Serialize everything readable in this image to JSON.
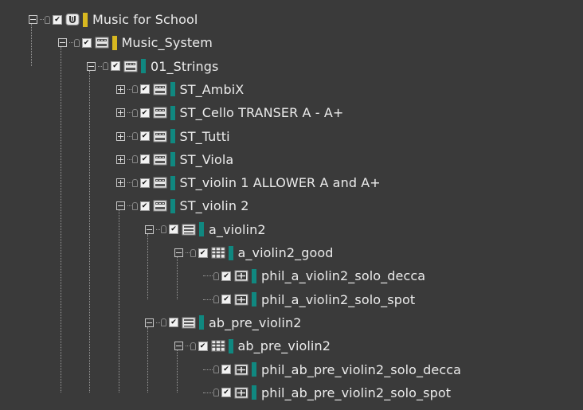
{
  "colors": {
    "background": "#3a3a3a",
    "yellow": "#d8b820",
    "teal": "#108880"
  },
  "tree": [
    {
      "label": "Music for School",
      "depth": 0,
      "expander": "minus",
      "icon": "master-bus-icon",
      "color": "#d8b820"
    },
    {
      "label": "Music_System",
      "depth": 1,
      "expander": "minus",
      "icon": "folder-bus-icon",
      "color": "#d8b820"
    },
    {
      "label": "01_Strings",
      "depth": 2,
      "expander": "minus",
      "icon": "folder-bus-icon",
      "color": "#108880"
    },
    {
      "label": "ST_AmbiX",
      "depth": 3,
      "expander": "plus",
      "icon": "folder-bus-icon",
      "color": "#108880"
    },
    {
      "label": "ST_Cello TRANSER A - A+",
      "depth": 3,
      "expander": "plus",
      "icon": "folder-bus-icon",
      "color": "#108880"
    },
    {
      "label": "ST_Tutti",
      "depth": 3,
      "expander": "plus",
      "icon": "folder-bus-icon",
      "color": "#108880"
    },
    {
      "label": "ST_Viola",
      "depth": 3,
      "expander": "plus",
      "icon": "folder-bus-icon",
      "color": "#108880"
    },
    {
      "label": "ST_violin 1 ALLOWER A and A+",
      "depth": 3,
      "expander": "plus",
      "icon": "folder-bus-icon",
      "color": "#108880"
    },
    {
      "label": "ST_violin 2",
      "depth": 3,
      "expander": "minus",
      "icon": "folder-bus-icon",
      "color": "#108880"
    },
    {
      "label": "a_violin2",
      "depth": 4,
      "expander": "minus",
      "icon": "actor-mixer-icon",
      "color": "#108880"
    },
    {
      "label": "a_violin2_good",
      "depth": 5,
      "expander": "minus",
      "icon": "grid-container-icon",
      "color": "#108880"
    },
    {
      "label": "phil_a_violin2_solo_decca",
      "depth": 6,
      "expander": "none",
      "icon": "sound-icon",
      "color": "#108880"
    },
    {
      "label": "phil_a_violin2_solo_spot",
      "depth": 6,
      "expander": "none",
      "icon": "sound-icon",
      "color": "#108880"
    },
    {
      "label": "ab_pre_violin2",
      "depth": 4,
      "expander": "minus",
      "icon": "actor-mixer-icon",
      "color": "#108880"
    },
    {
      "label": "ab_pre_violin2",
      "depth": 5,
      "expander": "minus",
      "icon": "grid-container-icon",
      "color": "#108880"
    },
    {
      "label": "phil_ab_pre_violin2_solo_decca",
      "depth": 6,
      "expander": "none",
      "icon": "sound-icon",
      "color": "#108880"
    },
    {
      "label": "phil_ab_pre_violin2_solo_spot",
      "depth": 6,
      "expander": "none",
      "icon": "sound-icon",
      "color": "#108880"
    }
  ]
}
